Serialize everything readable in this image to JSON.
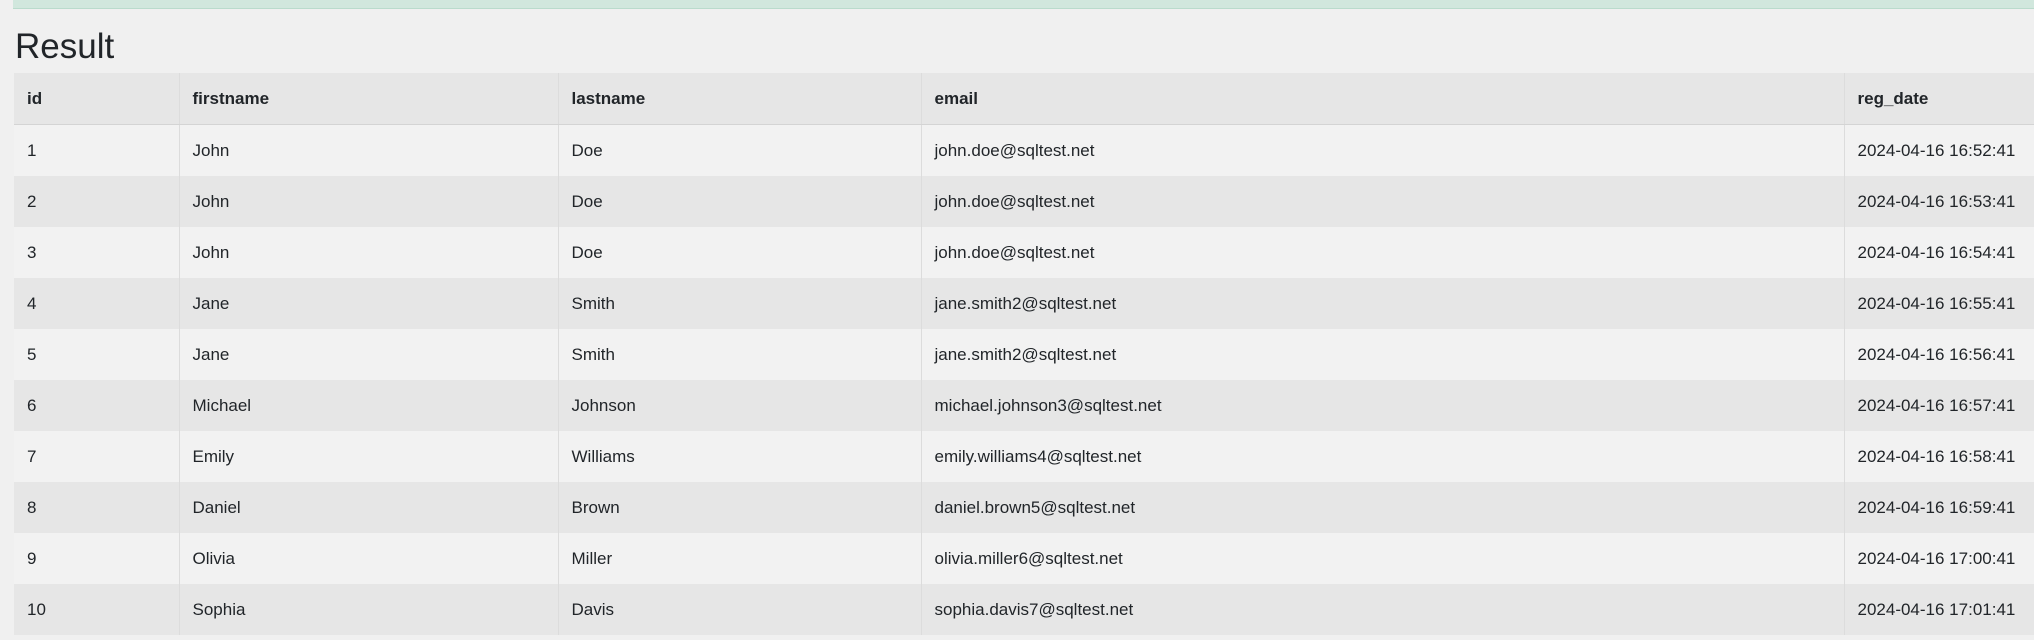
{
  "page": {
    "heading": "Result"
  },
  "colors": {
    "success_bar": "#d1e7dd",
    "background": "#f0f0f0",
    "row_odd": "#f2f2f2",
    "row_even": "#e6e6e6"
  },
  "table": {
    "columns": [
      "id",
      "firstname",
      "lastname",
      "email",
      "reg_date"
    ],
    "rows": [
      [
        "1",
        "John",
        "Doe",
        "john.doe@sqltest.net",
        "2024-04-16 16:52:41"
      ],
      [
        "2",
        "John",
        "Doe",
        "john.doe@sqltest.net",
        "2024-04-16 16:53:41"
      ],
      [
        "3",
        "John",
        "Doe",
        "john.doe@sqltest.net",
        "2024-04-16 16:54:41"
      ],
      [
        "4",
        "Jane",
        "Smith",
        "jane.smith2@sqltest.net",
        "2024-04-16 16:55:41"
      ],
      [
        "5",
        "Jane",
        "Smith",
        "jane.smith2@sqltest.net",
        "2024-04-16 16:56:41"
      ],
      [
        "6",
        "Michael",
        "Johnson",
        "michael.johnson3@sqltest.net",
        "2024-04-16 16:57:41"
      ],
      [
        "7",
        "Emily",
        "Williams",
        "emily.williams4@sqltest.net",
        "2024-04-16 16:58:41"
      ],
      [
        "8",
        "Daniel",
        "Brown",
        "daniel.brown5@sqltest.net",
        "2024-04-16 16:59:41"
      ],
      [
        "9",
        "Olivia",
        "Miller",
        "olivia.miller6@sqltest.net",
        "2024-04-16 17:00:41"
      ],
      [
        "10",
        "Sophia",
        "Davis",
        "sophia.davis7@sqltest.net",
        "2024-04-16 17:01:41"
      ]
    ]
  }
}
